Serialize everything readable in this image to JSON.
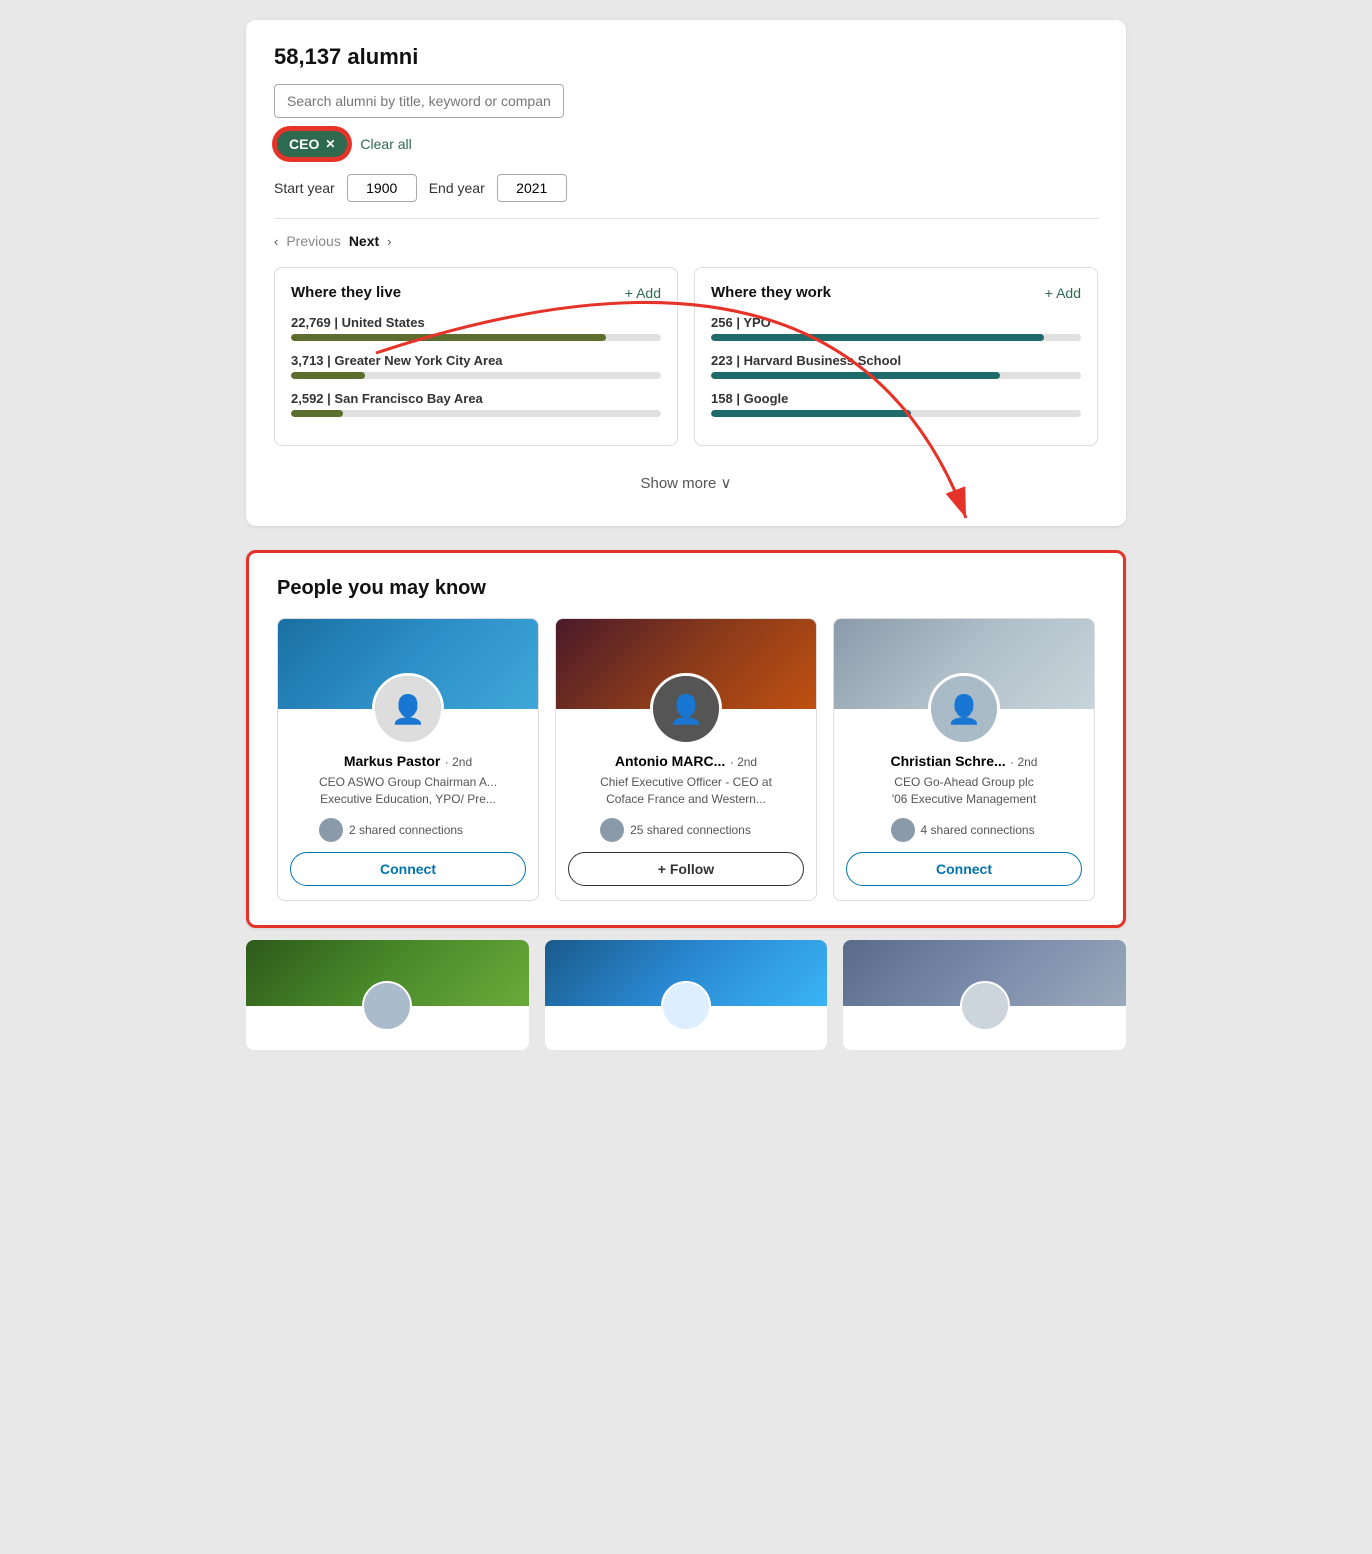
{
  "alumni": {
    "title": "58,137 alumni",
    "search_placeholder": "Search alumni by title, keyword or company",
    "ceo_tag": "CEO",
    "ceo_x": "✕",
    "clear_all": "Clear all",
    "start_year_label": "Start year",
    "start_year_value": "1900",
    "end_year_label": "End year",
    "end_year_value": "2021",
    "pagination": {
      "previous": "Previous",
      "next": "Next"
    },
    "where_live": {
      "title": "Where they live",
      "add": "+ Add",
      "items": [
        {
          "count": "22,769",
          "label": "United States",
          "pct": 85
        },
        {
          "count": "3,713",
          "label": "Greater New York City Area",
          "pct": 20
        },
        {
          "count": "2,592",
          "label": "San Francisco Bay Area",
          "pct": 14
        }
      ]
    },
    "where_work": {
      "title": "Where they work",
      "add": "+ Add",
      "items": [
        {
          "count": "256",
          "label": "YPO",
          "pct": 90
        },
        {
          "count": "223",
          "label": "Harvard Business School",
          "pct": 78
        },
        {
          "count": "158",
          "label": "Google",
          "pct": 54
        }
      ]
    },
    "show_more": "Show more ∨"
  },
  "people_section": {
    "title": "People you may know",
    "people": [
      {
        "name": "Markus Pastor",
        "degree": "· 2nd",
        "role": "CEO ASWO Group Chairman A... Executive Education, YPO/ Pre...",
        "shared": "2 shared connections",
        "action": "Connect",
        "action_type": "connect"
      },
      {
        "name": "Antonio MARC...",
        "degree": "· 2nd",
        "role": "Chief Executive Officer - CEO at Coface France and Western...",
        "shared": "25 shared connections",
        "action": "+ Follow",
        "action_type": "follow"
      },
      {
        "name": "Christian Schre...",
        "degree": "· 2nd",
        "role": "CEO Go-Ahead Group plc '06 Executive Management",
        "shared": "4 shared connections",
        "action": "Connect",
        "action_type": "connect"
      }
    ]
  },
  "bottom_cards": [
    {
      "cover_type": "green"
    },
    {
      "cover_type": "lightblue"
    },
    {
      "cover_type": "bluegray"
    }
  ]
}
